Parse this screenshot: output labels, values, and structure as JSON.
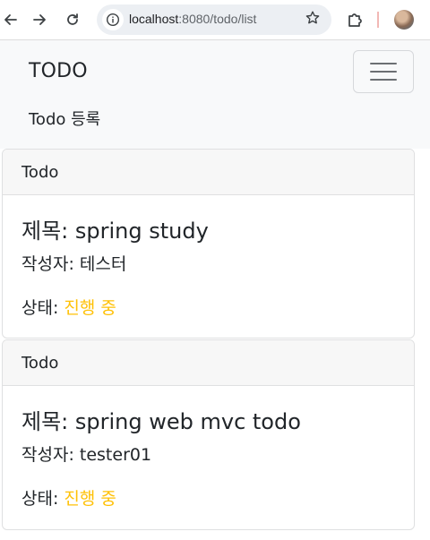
{
  "browser": {
    "url_host": "localhost",
    "url_rest": ":8080/todo/list",
    "icons": {
      "back": "back-arrow-icon",
      "forward": "forward-arrow-icon",
      "reload": "reload-icon",
      "site_info": "info-icon",
      "bookmark": "star-icon",
      "extensions": "puzzle-icon",
      "profile": "avatar"
    }
  },
  "navbar": {
    "brand": "TODO",
    "link": "Todo 등록",
    "toggler_icon": "hamburger-icon"
  },
  "todos": [
    {
      "header": "Todo",
      "title_label": "제목: ",
      "title": "spring study",
      "writer_label": "작성자: ",
      "writer": "테스터",
      "status_label": "상태: ",
      "status": "진행 중"
    },
    {
      "header": "Todo",
      "title_label": "제목: ",
      "title": "spring web mvc todo",
      "writer_label": "작성자: ",
      "writer": "tester01",
      "status_label": "상태: ",
      "status": "진행 중"
    }
  ],
  "colors": {
    "status": "#ffc107",
    "navbar_bg": "#f8f9fa",
    "card_header_bg": "#f7f7f7"
  }
}
